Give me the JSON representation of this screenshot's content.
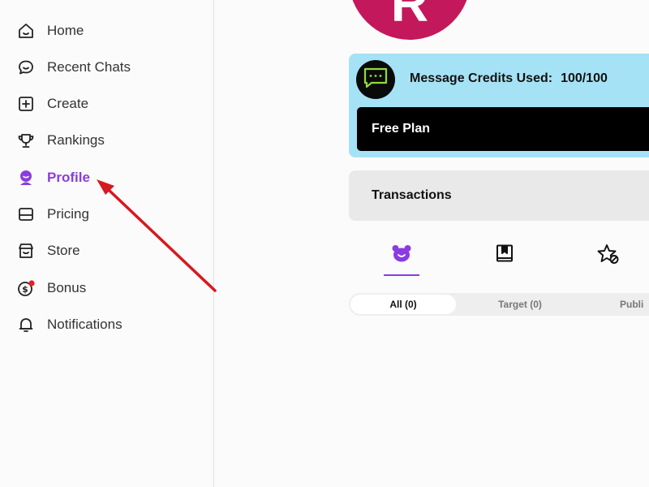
{
  "sidebar": {
    "items": [
      {
        "label": "Home",
        "icon": "home-icon"
      },
      {
        "label": "Recent Chats",
        "icon": "chat-bubble-icon"
      },
      {
        "label": "Create",
        "icon": "plus-square-icon"
      },
      {
        "label": "Rankings",
        "icon": "trophy-icon"
      },
      {
        "label": "Profile",
        "icon": "profile-icon",
        "active": true
      },
      {
        "label": "Pricing",
        "icon": "credit-card-icon"
      },
      {
        "label": "Store",
        "icon": "store-icon"
      },
      {
        "label": "Bonus",
        "icon": "bonus-coin-icon"
      },
      {
        "label": "Notifications",
        "icon": "bell-icon"
      }
    ]
  },
  "profile": {
    "avatar_initial": "R",
    "avatar_color": "#c4185c"
  },
  "credits": {
    "label": "Message Credits Used:",
    "value": "100/100",
    "plan": "Free Plan",
    "card_color": "#a6e2f5"
  },
  "transactions": {
    "label": "Transactions"
  },
  "icon_tabs": [
    {
      "icon": "bear-face-icon",
      "active": true
    },
    {
      "icon": "bookmark-book-icon"
    },
    {
      "icon": "star-hidden-icon"
    }
  ],
  "filters": [
    {
      "label": "All (0)",
      "active": true
    },
    {
      "label": "Target (0)"
    },
    {
      "label": "Publi"
    }
  ],
  "colors": {
    "accent": "#8a3ce0",
    "annotation_arrow": "#d71920",
    "notification_dot": "#e02424"
  }
}
